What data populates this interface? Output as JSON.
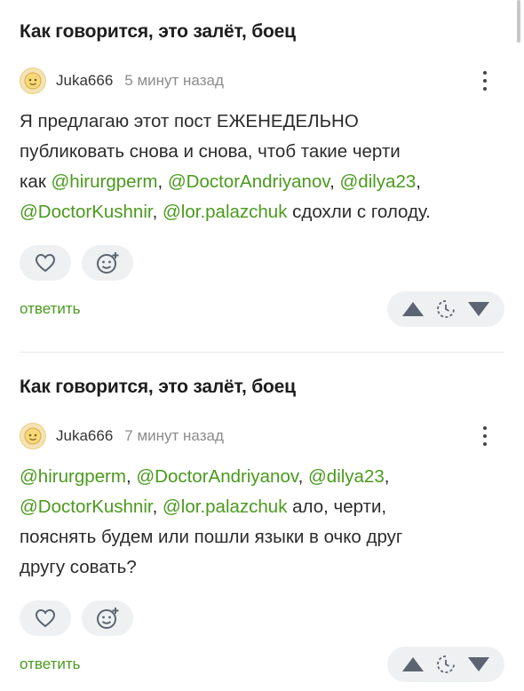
{
  "comments": [
    {
      "post_title": "Как говорится, это залёт, боец",
      "author": "Juka666",
      "time": "5 минут назад",
      "lines": [
        [
          {
            "text": "Я предлагаю этот пост ЕЖЕНЕДЕЛЬНО",
            "mention": false
          }
        ],
        [
          {
            "text": "публиковать снова и снова, чтоб такие черти",
            "mention": false
          }
        ],
        [
          {
            "text": "как ",
            "mention": false
          },
          {
            "text": "@hirurgperm",
            "mention": true
          },
          {
            "text": ", ",
            "mention": false
          },
          {
            "text": "@DoctorAndriyanov",
            "mention": true
          },
          {
            "text": ", ",
            "mention": false
          },
          {
            "text": "@dilya23",
            "mention": true
          },
          {
            "text": ",",
            "mention": false
          }
        ],
        [
          {
            "text": "@DoctorKushnir",
            "mention": true
          },
          {
            "text": ", ",
            "mention": false
          },
          {
            "text": "@lor.palazchuk",
            "mention": true
          },
          {
            "text": " сдохли с голоду.",
            "mention": false
          }
        ]
      ],
      "reply_label": "ответить"
    },
    {
      "post_title": "Как говорится, это залёт, боец",
      "author": "Juka666",
      "time": "7 минут назад",
      "lines": [
        [
          {
            "text": "@hirurgperm",
            "mention": true
          },
          {
            "text": ", ",
            "mention": false
          },
          {
            "text": "@DoctorAndriyanov",
            "mention": true
          },
          {
            "text": ", ",
            "mention": false
          },
          {
            "text": "@dilya23",
            "mention": true
          },
          {
            "text": ",",
            "mention": false
          }
        ],
        [
          {
            "text": "@DoctorKushnir",
            "mention": true
          },
          {
            "text": ", ",
            "mention": false
          },
          {
            "text": "@lor.palazchuk",
            "mention": true
          },
          {
            "text": " ало, черти,",
            "mention": false
          }
        ],
        [
          {
            "text": "пояснять будем или пошли языки в очко друг",
            "mention": false
          }
        ],
        [
          {
            "text": "другу совать?",
            "mention": false
          }
        ]
      ],
      "reply_label": "ответить"
    }
  ],
  "icons": {
    "avatar": "avatar-icon",
    "more": "more-vertical-icon",
    "like": "heart-icon",
    "reaction": "add-emoji-icon",
    "upvote": "triangle-up-icon",
    "save": "clock-icon",
    "downvote": "triangle-down-icon"
  },
  "colors": {
    "accent": "#4a9a1d",
    "pill_background": "#eef0f2",
    "icon": "#5b6470"
  }
}
